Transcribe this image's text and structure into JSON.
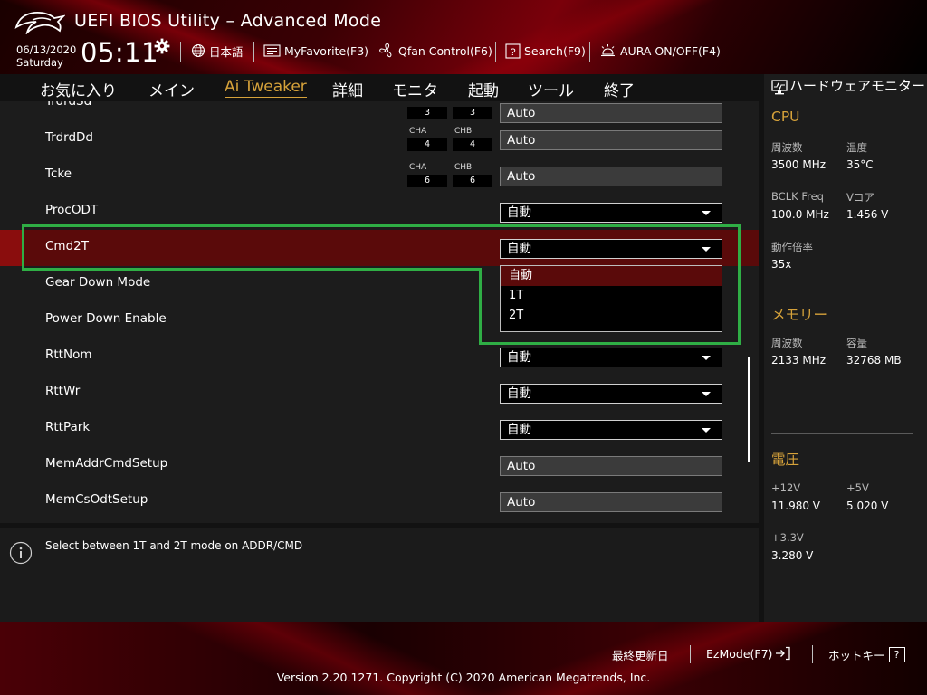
{
  "header": {
    "title": "UEFI BIOS Utility – Advanced Mode",
    "date": "06/13/2020",
    "day": "Saturday",
    "time": "05:11",
    "items": [
      {
        "label": "日本語",
        "icon": "globe-icon"
      },
      {
        "label": "MyFavorite(F3)",
        "icon": "favorite-icon"
      },
      {
        "label": "Qfan Control(F6)",
        "icon": "fan-icon"
      },
      {
        "label": "Search(F9)",
        "icon": "search-help-icon"
      },
      {
        "label": "AURA ON/OFF(F4)",
        "icon": "aura-icon"
      }
    ]
  },
  "tabs": [
    {
      "label": "お気に入り",
      "active": false
    },
    {
      "label": "メイン",
      "active": false
    },
    {
      "label": "Ai Tweaker",
      "active": true
    },
    {
      "label": "詳細",
      "active": false
    },
    {
      "label": "モニタ",
      "active": false
    },
    {
      "label": "起動",
      "active": false
    },
    {
      "label": "ツール",
      "active": false
    },
    {
      "label": "終了",
      "active": false
    }
  ],
  "settings": {
    "trdrdsd": {
      "label": "TrdrdSd",
      "cha_value": "3",
      "chb_value": "3",
      "value": "Auto"
    },
    "trdrddd": {
      "label": "TrdrdDd",
      "cha_label": "CHA",
      "chb_label": "CHB",
      "cha_value": "4",
      "chb_value": "4",
      "value": "Auto"
    },
    "tcke": {
      "label": "Tcke",
      "cha_label": "CHA",
      "chb_label": "CHB",
      "cha_value": "6",
      "chb_value": "6",
      "value": "Auto"
    },
    "procodt": {
      "label": "ProcODT",
      "value": "自動"
    },
    "cmd2t": {
      "label": "Cmd2T",
      "value": "自動"
    },
    "gear_down_mode": {
      "label": "Gear Down Mode"
    },
    "power_down_enable": {
      "label": "Power Down Enable"
    },
    "rttnom": {
      "label": "RttNom",
      "value": "自動"
    },
    "rttwr": {
      "label": "RttWr",
      "value": "自動"
    },
    "rttpark": {
      "label": "RttPark",
      "value": "自動"
    },
    "memaddrcmdsetup": {
      "label": "MemAddrCmdSetup",
      "value": "Auto"
    },
    "memcsodtsetup": {
      "label": "MemCsOdtSetup",
      "value": "Auto"
    }
  },
  "dropdown": {
    "options": [
      "自動",
      "1T",
      "2T"
    ],
    "selected_index": 0
  },
  "help": {
    "text": "Select between 1T and 2T mode on ADDR/CMD"
  },
  "monitor": {
    "title": "ハードウェアモニター",
    "cpu": {
      "title": "CPU",
      "freq_label": "周波数",
      "freq_value": "3500 MHz",
      "temp_label": "温度",
      "temp_value": "35°C",
      "bclk_label": "BCLK Freq",
      "bclk_value": "100.0 MHz",
      "vcore_label": "Vコア",
      "vcore_value": "1.456 V",
      "ratio_label": "動作倍率",
      "ratio_value": "35x"
    },
    "memory": {
      "title": "メモリー",
      "freq_label": "周波数",
      "freq_value": "2133 MHz",
      "cap_label": "容量",
      "cap_value": "32768 MB"
    },
    "voltage": {
      "title": "電圧",
      "v12_label": "+12V",
      "v12_value": "11.980 V",
      "v5_label": "+5V",
      "v5_value": "5.020 V",
      "v33_label": "+3.3V",
      "v33_value": "3.280 V"
    }
  },
  "footer": {
    "last_modified": "最終更新日",
    "ezmode": "EzMode(F7)",
    "hotkeys": "ホットキー",
    "hotkeys_key": "?",
    "copyright": "Version 2.20.1271. Copyright (C) 2020 American Megatrends, Inc."
  },
  "colors": {
    "accent": "#d6a23a",
    "highlight_row": "#5a0a0a",
    "annotation": "#2fae45"
  }
}
